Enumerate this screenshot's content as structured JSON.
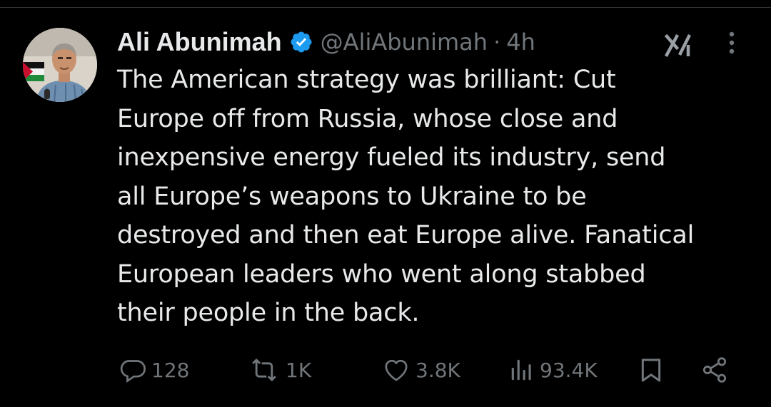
{
  "tweet": {
    "author": {
      "display_name": "Ali Abunimah",
      "handle": "@AliAbunimah",
      "verified": true
    },
    "separator": "·",
    "time": "4h",
    "text": "The American strategy was brilliant: Cut\nEurope off from Russia, whose close and\ninexpensive energy fueled its industry, send\nall Europe’s weapons to Ukraine to be\ndestroyed and then eat Europe alive. Fanatical\nEuropean leaders who went along stabbed\ntheir people in the back.",
    "stats": {
      "replies": "128",
      "reposts": "1K",
      "likes": "3.8K",
      "views": "93.4K"
    }
  },
  "icons": {
    "verified": "verified-badge-icon",
    "grok": "grok-icon",
    "more": "more-vertical-icon",
    "reply": "reply-icon",
    "repost": "repost-icon",
    "like": "heart-icon",
    "views": "views-icon",
    "bookmark": "bookmark-icon",
    "share": "share-icon"
  },
  "colors": {
    "background": "#000000",
    "primary_text": "#e7e9ea",
    "secondary_text": "#71767b",
    "verified_blue": "#1d9bf0"
  }
}
